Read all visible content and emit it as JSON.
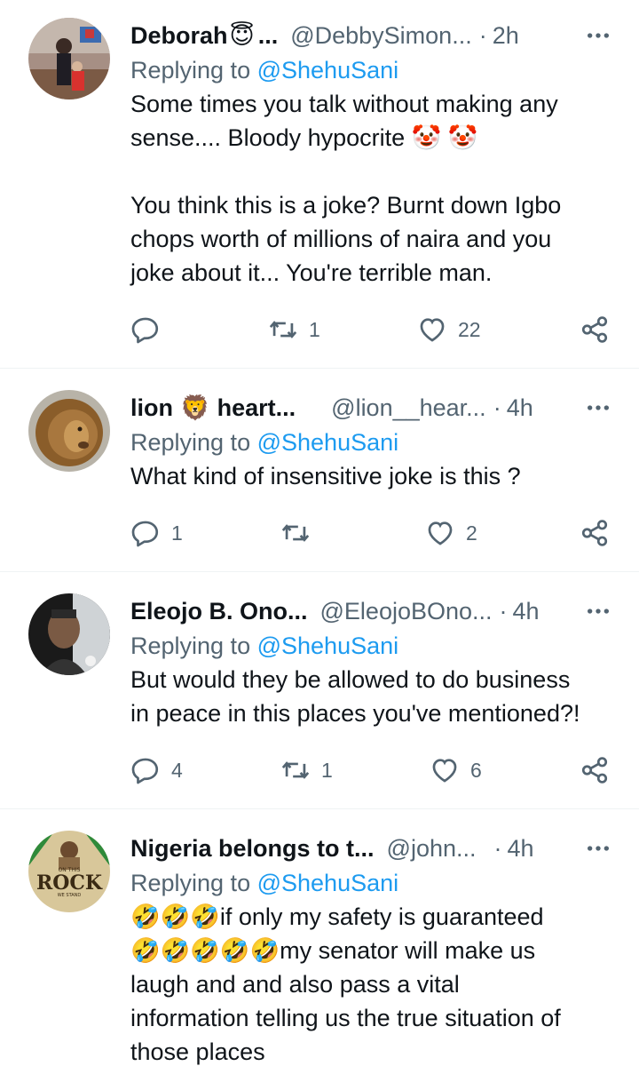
{
  "replies": [
    {
      "name": "Deborah",
      "name_emoji": "😇",
      "name_ellipsis": "...",
      "handle": "@DebbySimon...",
      "dot": "·",
      "time": "2h",
      "replying_prefix": "Replying to",
      "replying_to": "@ShehuSani",
      "text": "Some times you talk without making any\nsense.... Bloody hypocrite 🤡 🤡\n\nYou think this is a joke? Burnt down Igbo\nchops worth of millions of naira and you\njoke about it... You're terrible man.",
      "reply_count": "",
      "retweet_count": "1",
      "like_count": "22"
    },
    {
      "name": "lion",
      "name_emoji": "🦁",
      "name_suffix": "heart...",
      "handle": "@lion__hear...",
      "dot": "·",
      "time": "4h",
      "replying_prefix": "Replying to",
      "replying_to": "@ShehuSani",
      "text": "What kind of insensitive joke is this ?",
      "reply_count": "1",
      "retweet_count": "",
      "like_count": "2"
    },
    {
      "name": "Eleojo B. Ono...",
      "handle": "@EleojoBOno...",
      "dot": "·",
      "time": "4h",
      "replying_prefix": "Replying to",
      "replying_to": "@ShehuSani",
      "text": "But would they be allowed to do business\nin peace in this places you've mentioned?!",
      "reply_count": "4",
      "retweet_count": "1",
      "like_count": "6"
    },
    {
      "name": "Nigeria belongs to t...",
      "handle": "@john...",
      "dot": "·",
      "time": "4h",
      "replying_prefix": "Replying to",
      "replying_to": "@ShehuSani",
      "text": "🤣🤣🤣if only my safety is guaranteed\n🤣🤣🤣🤣🤣my senator will make us\nlaugh and and also pass a vital\ninformation telling us the true situation of\nthose places",
      "reply_count": "",
      "retweet_count": "",
      "like_count": "",
      "avatar_text": {
        "top": "ON THIS",
        "main": "ROCK",
        "bottom": "WE STAND"
      }
    }
  ],
  "icons": {
    "more": "more-dots-icon",
    "reply": "reply-bubble-icon",
    "retweet": "retweet-icon",
    "like": "heart-icon",
    "share": "share-icon"
  },
  "colors": {
    "link": "#1d9bf0",
    "secondary": "#536471",
    "text": "#0f1419"
  }
}
